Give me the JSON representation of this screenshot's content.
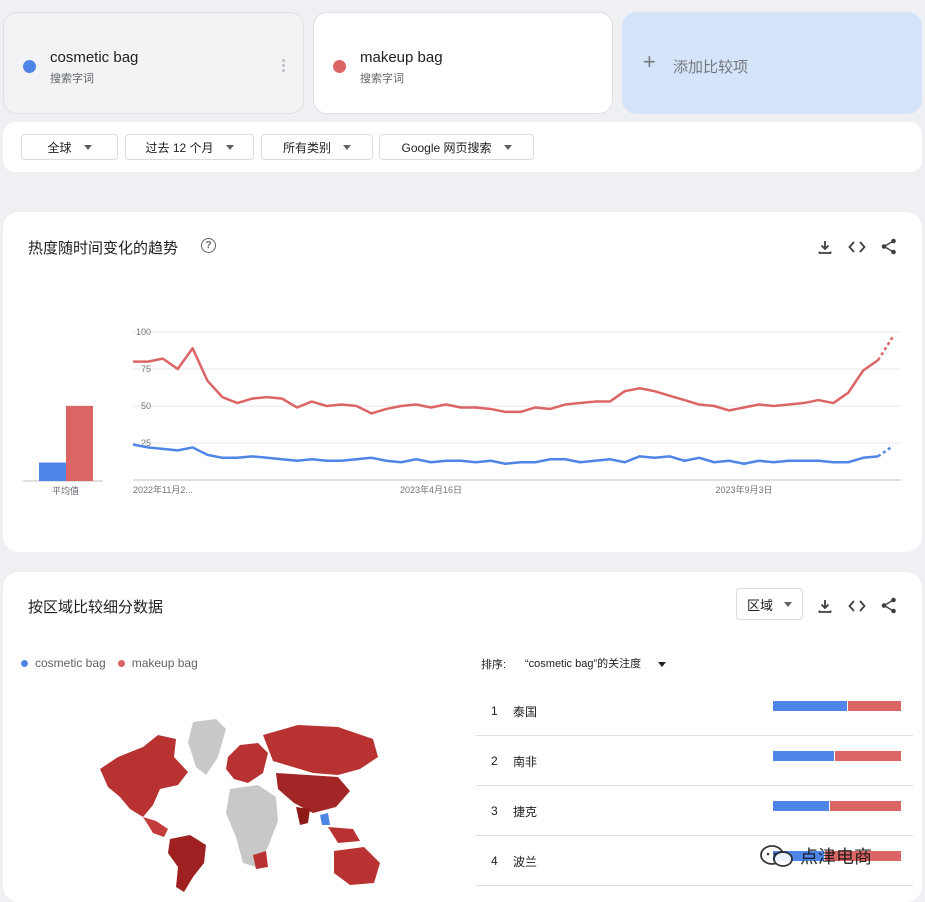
{
  "terms": [
    {
      "name": "cosmetic bag",
      "sub": "搜索字词",
      "color": "#4f85e6"
    },
    {
      "name": "makeup bag",
      "sub": "搜索字词",
      "color": "#db6464"
    }
  ],
  "add_compare": "添加比较项",
  "filters": {
    "region": "全球",
    "time": "过去 12 个月",
    "category": "所有类别",
    "search_type": "Google 网页搜索"
  },
  "trend": {
    "title": "热度随时间变化的趋势",
    "avg_label": "平均值"
  },
  "chart_data": {
    "type": "line",
    "y_ticks": [
      "100",
      "75",
      "50",
      "25"
    ],
    "ylim": [
      0,
      100
    ],
    "x_tick_labels": [
      "2022年11月2...",
      "2023年4月16日",
      "2023年9月3日"
    ],
    "x_tick_index": [
      0,
      20,
      41
    ],
    "averages": {
      "cosmetic bag": 14,
      "makeup bag": 57
    },
    "series": [
      {
        "name": "cosmetic bag",
        "color": "#4f85e6",
        "values": [
          24,
          22,
          21,
          20,
          22,
          17,
          15,
          15,
          16,
          15,
          14,
          13,
          14,
          13,
          13,
          14,
          15,
          13,
          12,
          14,
          12,
          13,
          13,
          12,
          13,
          11,
          12,
          12,
          14,
          14,
          12,
          13,
          14,
          12,
          16,
          15,
          16,
          13,
          15,
          12,
          13,
          11,
          13,
          12,
          13,
          13,
          13,
          12,
          12,
          15,
          16,
          23
        ]
      },
      {
        "name": "makeup bag",
        "color": "#db6464",
        "values": [
          80,
          80,
          82,
          75,
          89,
          67,
          56,
          52,
          55,
          56,
          55,
          49,
          53,
          50,
          51,
          50,
          45,
          48,
          50,
          51,
          49,
          51,
          49,
          49,
          48,
          46,
          46,
          49,
          48,
          51,
          52,
          53,
          53,
          60,
          62,
          60,
          57,
          54,
          51,
          50,
          47,
          49,
          51,
          50,
          51,
          52,
          54,
          52,
          59,
          74,
          81,
          97
        ]
      }
    ],
    "partial_from_index": 50
  },
  "regions": {
    "title": "按区域比较细分数据",
    "selector": "区域",
    "legend": [
      "cosmetic bag",
      "makeup bag"
    ],
    "sort_label": "排序:",
    "sort_value": "“cosmetic bag”的关注度",
    "rows": [
      {
        "rank": "1",
        "name": "泰国",
        "blue": 58,
        "red": 42
      },
      {
        "rank": "2",
        "name": "南非",
        "blue": 48,
        "red": 52
      },
      {
        "rank": "3",
        "name": "捷克",
        "blue": 44,
        "red": 56
      },
      {
        "rank": "4",
        "name": "波兰",
        "blue": 40,
        "red": 60
      }
    ]
  },
  "watermark": "点津电商"
}
